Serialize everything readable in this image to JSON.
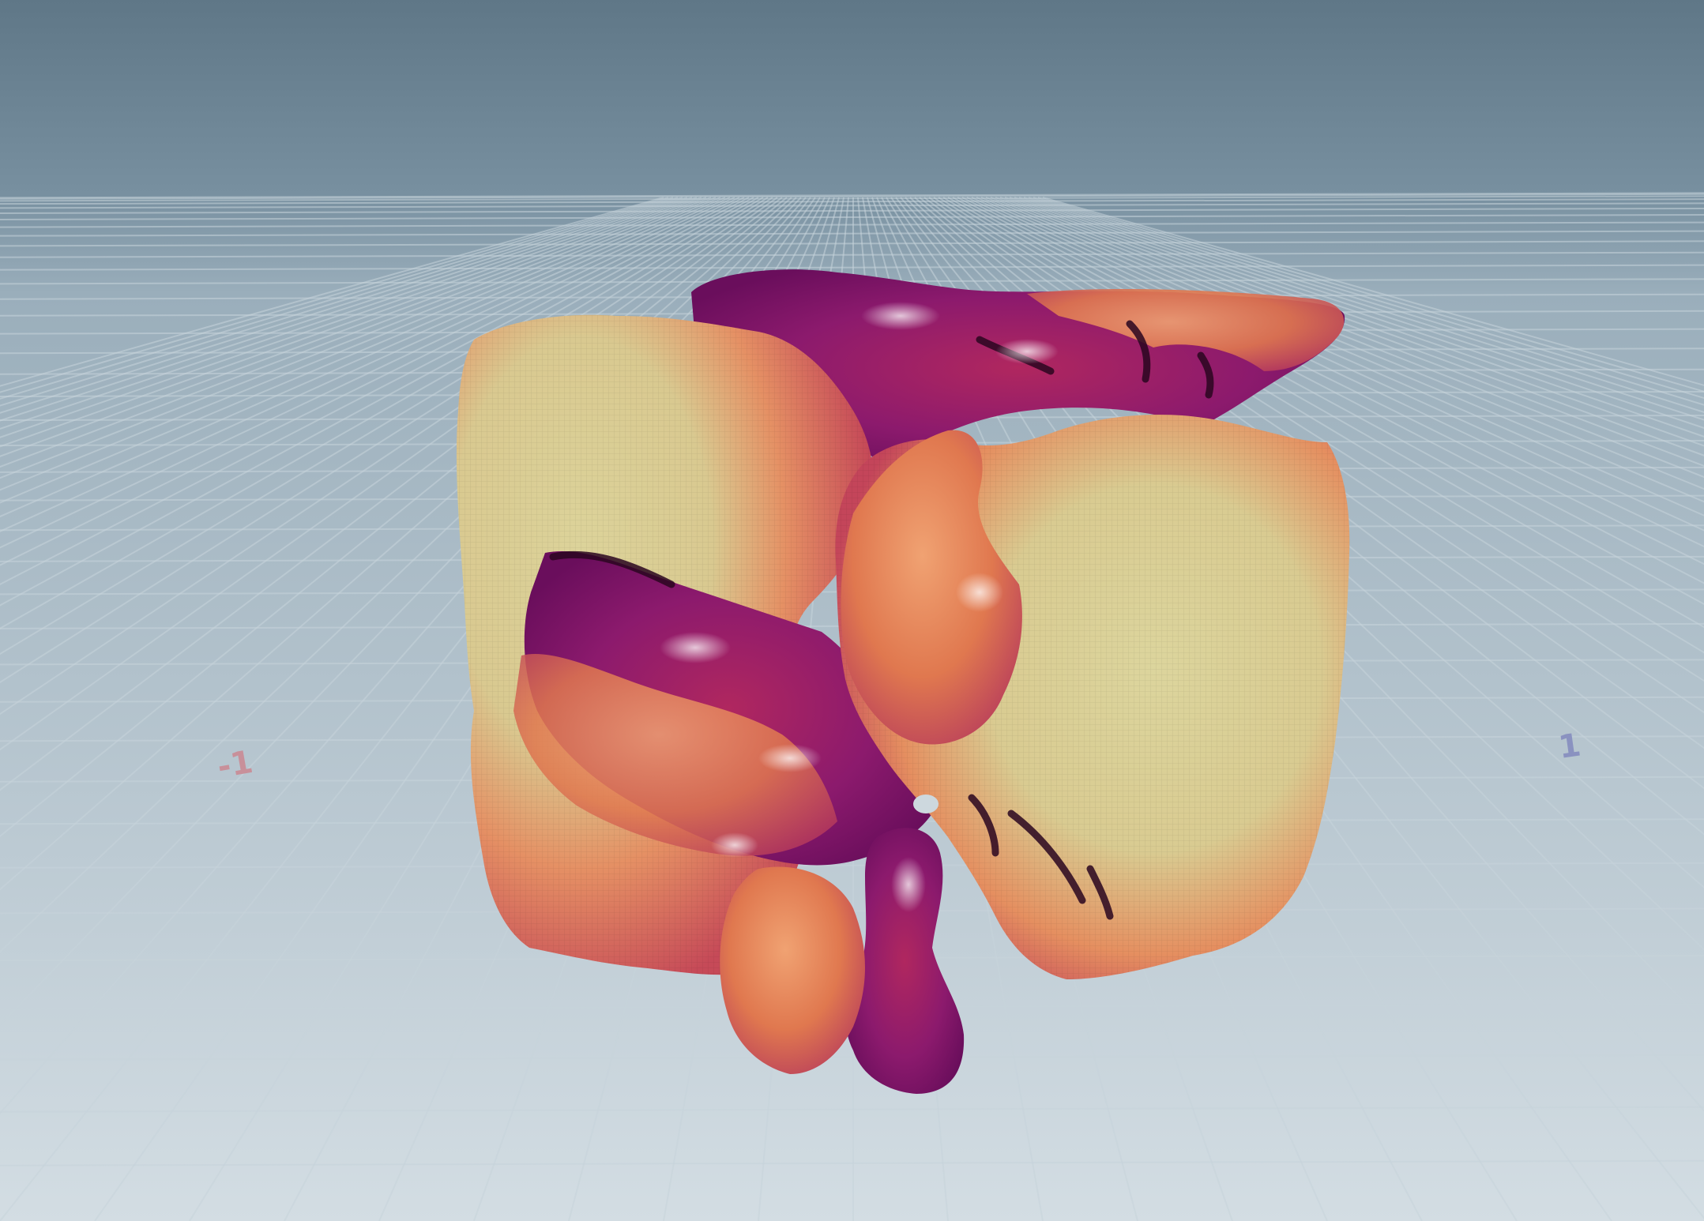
{
  "viewport": {
    "grid_axis_labels": [
      {
        "id": "neg-x",
        "text": "-1",
        "color": "#c8909a"
      },
      {
        "id": "pos-x",
        "text": "1",
        "color": "#8a92c0"
      }
    ]
  },
  "colors": {
    "sky_top": "#61798a",
    "sky_horizon": "#9db0bd",
    "floor_far": "#9eb1bd",
    "floor_near": "#cdd9df",
    "grid_line": "#b8c7cf",
    "surface_light": "#d9cf94",
    "surface_mid": "#e48a5c",
    "surface_warm": "#c9475a",
    "surface_deep": "#8a1670",
    "surface_shadow": "#3a0a30"
  },
  "icons": {
    "mesh": "blob-mesh-icon"
  }
}
